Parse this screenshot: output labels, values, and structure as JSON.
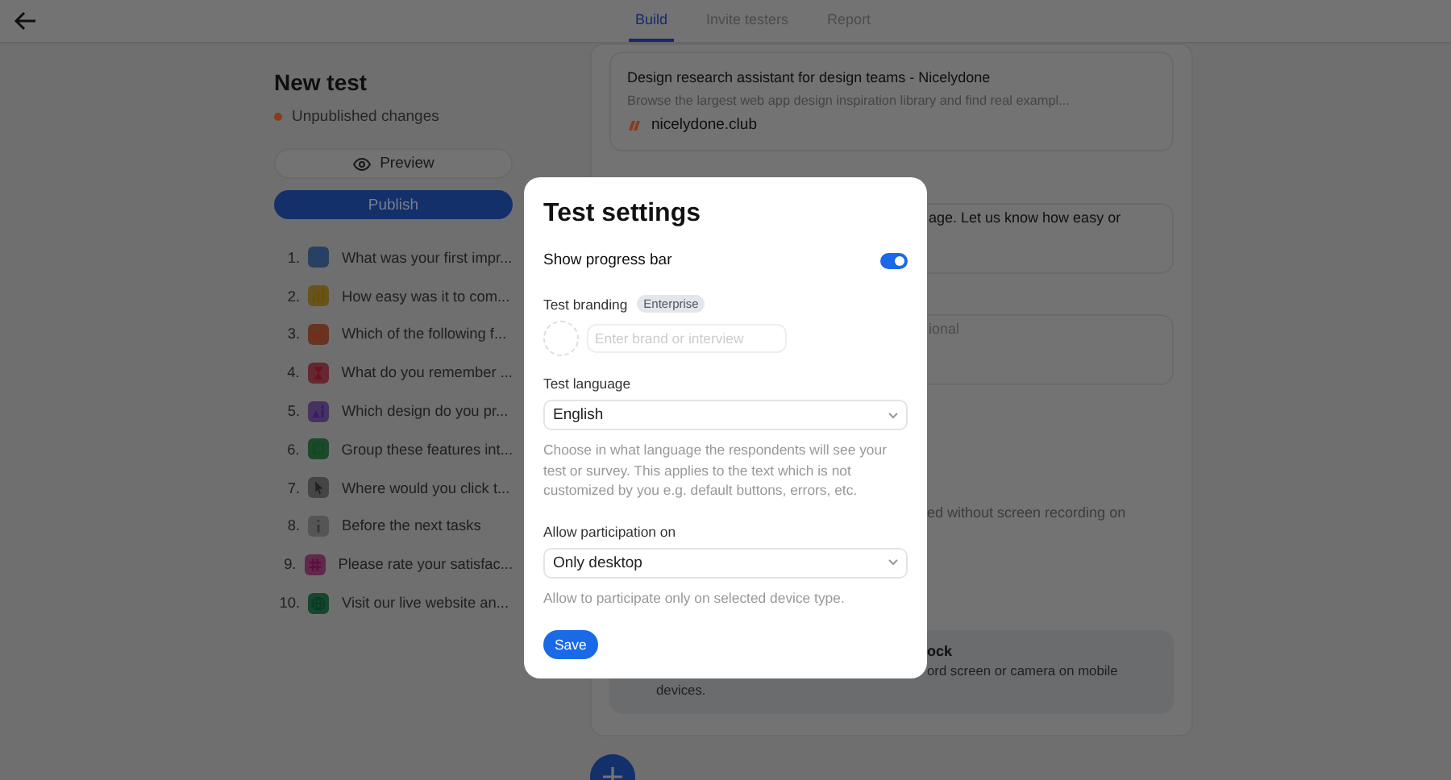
{
  "header": {
    "tabs": [
      {
        "label": "Build",
        "selected": true
      },
      {
        "label": "Invite testers",
        "selected": false
      },
      {
        "label": "Report",
        "selected": false
      }
    ]
  },
  "sidebar": {
    "title": "New test",
    "status": "Unpublished changes",
    "preview_button": "Preview",
    "publish_button": "Publish",
    "items": [
      {
        "number": "1.",
        "kind": "question",
        "color": "#294060",
        "text": "What was your first impr..."
      },
      {
        "number": "2.",
        "kind": "bars",
        "color": "#68531a",
        "text": "How easy was it to com..."
      },
      {
        "number": "3.",
        "kind": "check",
        "color": "#683421",
        "text": "Which of the following f..."
      },
      {
        "number": "4.",
        "kind": "hourglass",
        "color": "#652730",
        "text": "What do you remember ..."
      },
      {
        "number": "5.",
        "kind": "people",
        "color": "#463260",
        "text": "Which design do you pr..."
      },
      {
        "number": "6.",
        "kind": "cards",
        "color": "#1c4929",
        "text": "Group these features int..."
      },
      {
        "number": "7.",
        "kind": "cursor",
        "color": "#454545",
        "text": "Where would you click t..."
      },
      {
        "number": "8.",
        "kind": "info",
        "color": "#555555",
        "text": "Before the next tasks"
      },
      {
        "number": "9.",
        "kind": "hash",
        "color": "#60294b",
        "text": "Please rate your satisfac..."
      },
      {
        "number": "10.",
        "kind": "globe",
        "color": "#154730",
        "text": "Visit our live website an..."
      }
    ]
  },
  "content": {
    "link_card": {
      "title": "Design research assistant for design teams - Nicelydone",
      "description": "Browse the largest web app design inspiration library and find real exampl...",
      "domain": "nicelydone.club"
    },
    "fragments": [
      "age. Let us know how easy or",
      "ional",
      "ed without screen recording on"
    ],
    "notice": {
      "title": "ock",
      "text": "ord screen or camera on mobile",
      "text_end": "devices."
    }
  },
  "dialog": {
    "title": "Test settings",
    "progress_bar": {
      "label": "Show progress bar",
      "on": true
    },
    "branding": {
      "label": "Test branding",
      "badge": "Enterprise",
      "placeholder": "Enter brand or interview"
    },
    "language": {
      "label": "Test language",
      "value": "English",
      "help": "Choose in what language the respondents will see your test or survey. This applies to the text which is not customized by you e.g. default buttons, errors, etc."
    },
    "participation": {
      "label": "Allow participation on",
      "value": "Only desktop",
      "help": "Allow to participate only on selected device type."
    },
    "save_button": "Save"
  }
}
